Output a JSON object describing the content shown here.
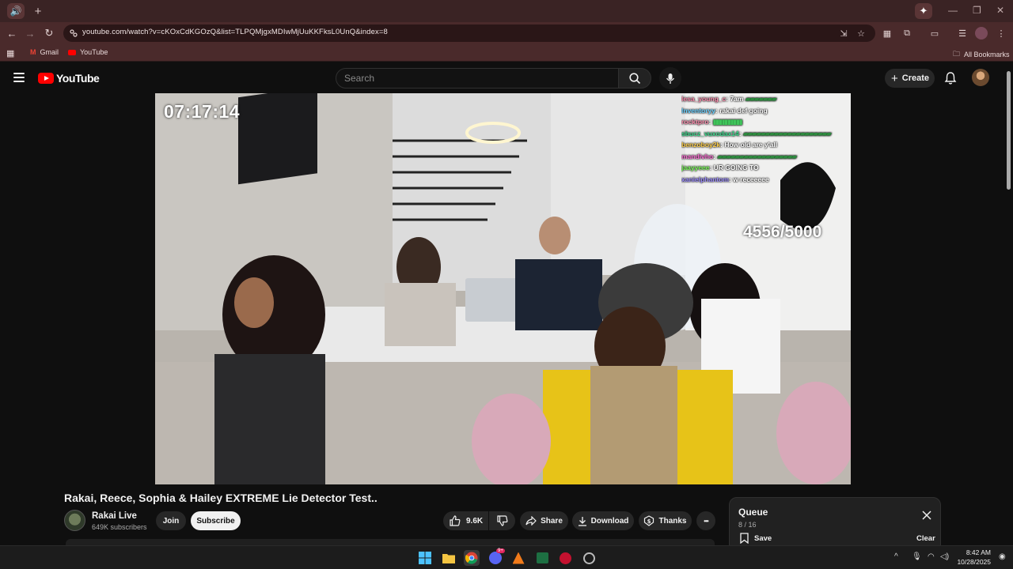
{
  "browser": {
    "tab_audio_glyph": "🔊",
    "new_tab_glyph": "+",
    "url": "youtube.com/watch?v=cKOxCdKGOzQ&list=TLPQMjgxMDIwMjUuKKFksL0UnQ&index=8",
    "bookmarks": [
      {
        "label": "Gmail",
        "icon": "gmail-icon"
      },
      {
        "label": "YouTube",
        "icon": "youtube-icon"
      }
    ],
    "all_bookmarks_label": "All Bookmarks"
  },
  "youtube": {
    "logo_text": "YouTube",
    "search_placeholder": "Search",
    "create_label": "Create"
  },
  "player": {
    "timer": "07:17:14",
    "counter": "4556/5000",
    "chat": [
      {
        "user": "lesa_young_c",
        "msg": "7am",
        "flags": "▰▰▰▰▰▰▰",
        "user_color": "#ff8fb0"
      },
      {
        "user": "Inventoryy",
        "msg": "rakai def going",
        "flags": "",
        "user_color": "#6ad0ff"
      },
      {
        "user": "rocktpro",
        "msg": "",
        "flags": "▮▮▮▮▮▮▮▮▮▮",
        "user_color": "#ff8fb0"
      },
      {
        "user": "sbucz_vuxodax14",
        "msg": "",
        "flags": "▰▰▰▰▰▰▰▰▰▰▰▰▰▰▰▰▰▰▰▰",
        "user_color": "#38d98a"
      },
      {
        "user": "benzoboy2k",
        "msg": "How old are y'all",
        "flags": "",
        "user_color": "#ffcf4a"
      },
      {
        "user": "mandivho",
        "msg": "",
        "flags": "▰▰▰▰▰▰▰▰▰▰▰▰▰▰▰▰▰▰",
        "user_color": "#ff6bd5"
      },
      {
        "user": "jaayyeee",
        "msg": "UR GOING TO",
        "flags": "",
        "user_color": "#7dff5c"
      },
      {
        "user": "xanielphantom",
        "msg": "w receeeee",
        "flags": "",
        "user_color": "#9b8cff"
      }
    ]
  },
  "video": {
    "title": "Rakai, Reece, Sophia & Hailey EXTREME Lie Detector Test..",
    "channel_name": "Rakai Live",
    "subscribers": "649K subscribers",
    "join_label": "Join",
    "subscribe_label": "Subscribe",
    "likes": "9.6K",
    "share_label": "Share",
    "download_label": "Download",
    "thanks_label": "Thanks",
    "more_glyph": "•••"
  },
  "queue": {
    "title": "Queue",
    "count": "8 / 16",
    "save_label": "Save",
    "clear_label": "Clear"
  },
  "taskbar": {
    "time": "8:42 AM",
    "date": "10/28/2025",
    "badge": "9+"
  }
}
